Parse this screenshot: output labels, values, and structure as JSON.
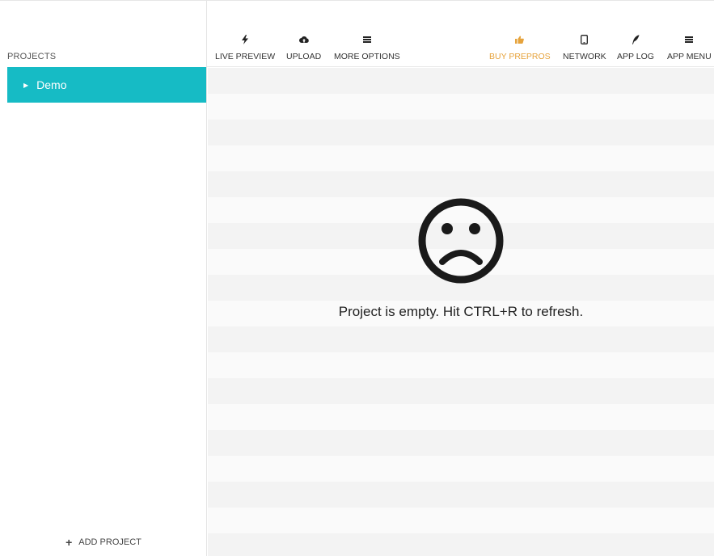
{
  "window": {
    "controls": [
      "minimize",
      "maximize",
      "close"
    ],
    "colors": {
      "minimize": "#f0b838",
      "maximize": "#46c86a",
      "close": "#e8523b"
    }
  },
  "sidebar": {
    "heading": "PROJECTS",
    "projects": [
      {
        "label": "Demo",
        "selected": true
      }
    ],
    "add_project_label": "ADD PROJECT",
    "accent_color": "#16bbc5"
  },
  "toolbar": {
    "left": [
      {
        "label": "LIVE PREVIEW",
        "icon": "lightning-icon"
      },
      {
        "label": "UPLOAD",
        "icon": "cloud-upload-icon"
      },
      {
        "label": "MORE OPTIONS",
        "icon": "menu-icon"
      }
    ],
    "right": [
      {
        "label": "BUY PREPROS",
        "icon": "thumbs-up-icon",
        "color": "#e6a33c"
      },
      {
        "label": "NETWORK",
        "icon": "mobile-icon"
      },
      {
        "label": "APP LOG",
        "icon": "feather-icon"
      },
      {
        "label": "APP MENU",
        "icon": "menu-icon"
      }
    ]
  },
  "main": {
    "empty_icon": "sad-face-icon",
    "empty_message": "Project is empty. Hit CTRL+R to refresh."
  }
}
